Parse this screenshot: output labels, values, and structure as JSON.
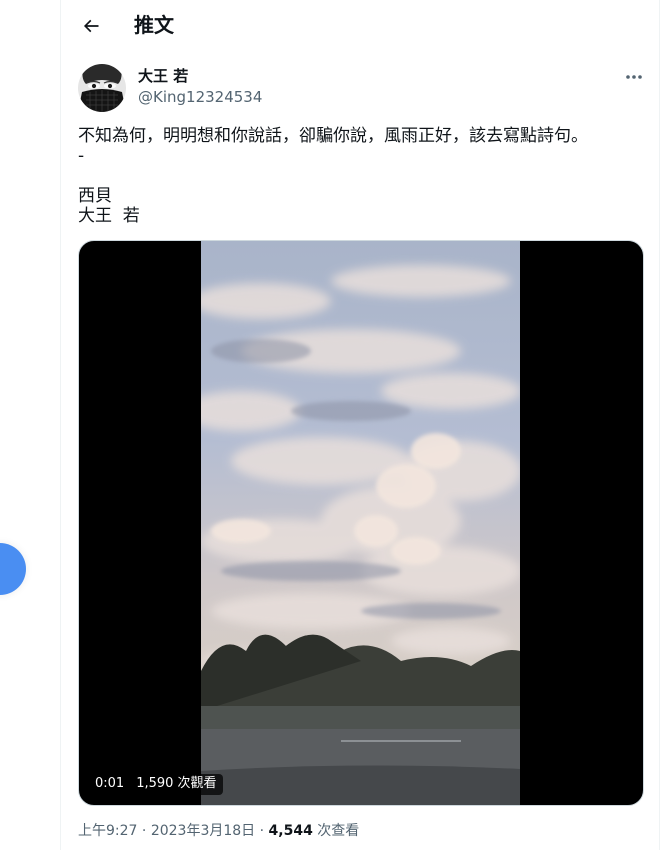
{
  "header": {
    "title": "推文"
  },
  "tweet": {
    "display_name": "大王 若",
    "handle": "@King12324534",
    "text_lines": [
      "不知為何，明明想和你說話，卻騙你說，風雨正好，該去寫點詩句。",
      "-"
    ],
    "signature_lines": [
      "西貝",
      "大王  若"
    ]
  },
  "media": {
    "current_time": "0:01",
    "view_count": "1,590 次觀看"
  },
  "meta": {
    "time": "上午9:27",
    "separator": "·",
    "date": "2023年3月18日",
    "views": "4,544",
    "views_suffix": "次查看"
  },
  "colors": {
    "fab": "#4a8ef2",
    "secondary_text": "#536471"
  },
  "icons": [
    "back-arrow-icon",
    "more-icon"
  ]
}
